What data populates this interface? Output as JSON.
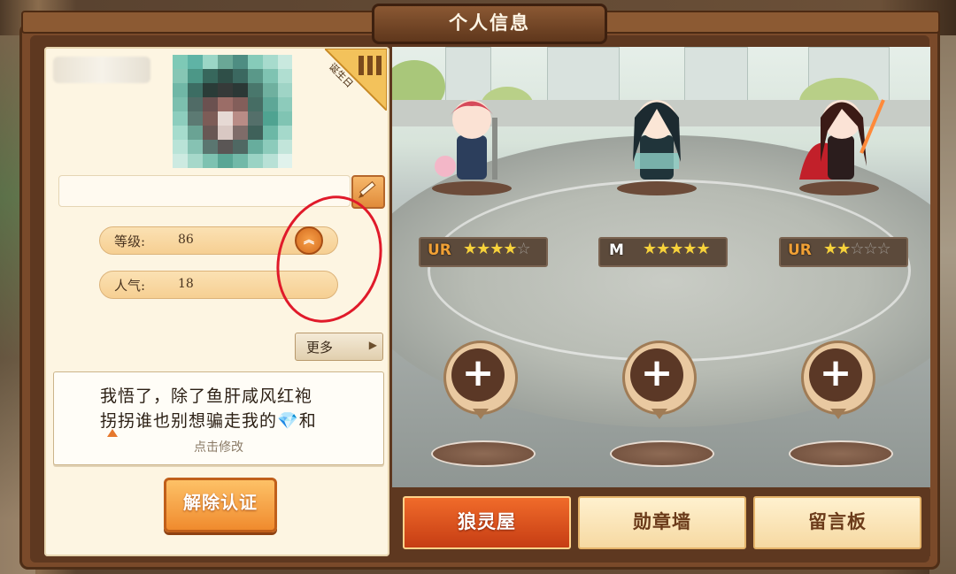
{
  "window": {
    "title": "个人信息"
  },
  "profile": {
    "birthday_badge": "诞生日",
    "level": {
      "label": "等级:",
      "value": "86"
    },
    "popularity": {
      "label": "人气:",
      "value": "18"
    },
    "more_button": "更多",
    "signature": {
      "line1": "我悟了，除了鱼肝咸风红袍",
      "line2a": "拐拐谁也别想骗走我的",
      "gem": "💎",
      "line2b": "和",
      "hint": "点击修改"
    },
    "unauth_button": "解除认证"
  },
  "team": [
    {
      "grade": "UR",
      "stars_filled": 4,
      "stars_total": 5
    },
    {
      "grade": "M",
      "stars_filled": 5,
      "stars_total": 5
    },
    {
      "grade": "UR",
      "stars_filled": 2,
      "stars_total": 5
    }
  ],
  "empty_slots": [
    "+",
    "+",
    "+"
  ],
  "tabs": [
    {
      "label": "狼灵屋",
      "active": true
    },
    {
      "label": "勋章墙",
      "active": false
    },
    {
      "label": "留言板",
      "active": false
    }
  ],
  "colors": {
    "accent": "#f06b2a",
    "frame": "#7a4a2a",
    "annotation_circle": "#e01a2a"
  },
  "icons": {
    "edit": "pencil-icon",
    "level_up": "double-chevron-up-icon",
    "more": "triangle-right-icon",
    "slot": "plus-icon"
  }
}
